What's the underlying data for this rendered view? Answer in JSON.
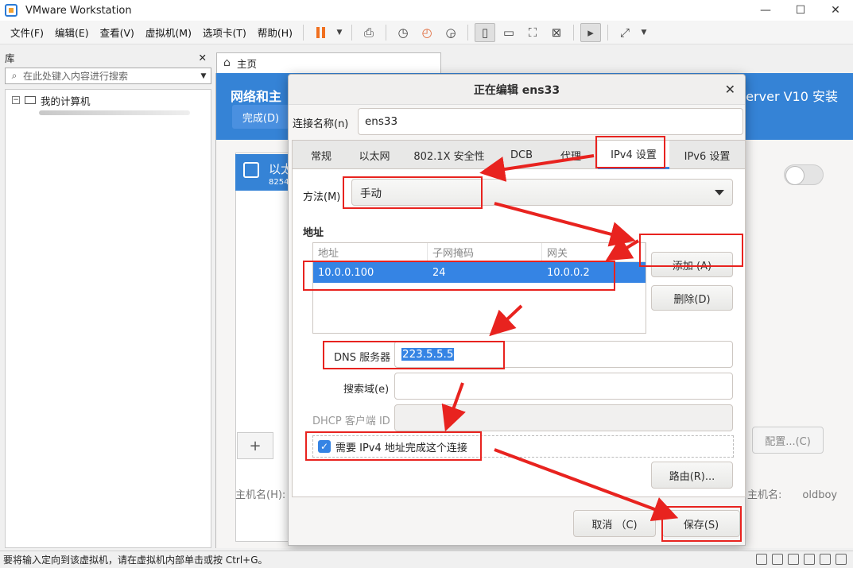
{
  "window": {
    "title": "VMware Workstation",
    "minimize": "—",
    "maximize": "☐",
    "close": "✕"
  },
  "menu": {
    "items": [
      "文件(F)",
      "编辑(E)",
      "查看(V)",
      "虚拟机(M)",
      "选项卡(T)",
      "帮助(H)"
    ]
  },
  "library": {
    "title": "库",
    "close": "✕",
    "search_placeholder": "在此处键入内容进行搜索",
    "tree_root": "我的计算机"
  },
  "tabs": {
    "home": "主页"
  },
  "guest": {
    "header_left": "网络和主",
    "done_button": "完成(D)",
    "header_right": "Server V10 安装",
    "item_name": "以太",
    "item_sub": "8254",
    "add": "+",
    "hostname_label": "主机名(H):",
    "config_button": "配置...(C)",
    "hostname_label_right": "主机名:",
    "hostname_value": "oldboy"
  },
  "dialog": {
    "title": "正在编辑 ens33",
    "close": "✕",
    "connection_name_label": "连接名称(n)",
    "connection_name_value": "ens33",
    "tabs": [
      "常规",
      "以太网",
      "802.1X 安全性",
      "DCB",
      "代理",
      "IPv4 设置",
      "IPv6 设置"
    ],
    "active_tab": "IPv4 设置",
    "method_label": "方法(M)",
    "method_value": "手动",
    "address_heading": "地址",
    "address_columns": [
      "地址",
      "子网掩码",
      "网关"
    ],
    "address_rows": [
      [
        "10.0.0.100",
        "24",
        "10.0.0.2"
      ]
    ],
    "add_button": "添加 (A)",
    "delete_button": "删除(D)",
    "dns_label": "DNS 服务器",
    "dns_value": "223.5.5.5",
    "search_domain_label": "搜索域(e)",
    "search_domain_value": "",
    "dhcp_client_id_label": "DHCP 客户端 ID",
    "dhcp_client_id_value": "",
    "require_ipv4_label": "需要 IPv4 地址完成这个连接",
    "require_ipv4_checked": true,
    "routes_button": "路由(R)...",
    "cancel_button": "取消 （C)",
    "save_button": "保存(S)"
  },
  "status": {
    "text": "要将输入定向到该虚拟机，请在虚拟机内部单击或按 Ctrl+G。"
  },
  "colors": {
    "accent": "#3584e4",
    "annotation": "#e8231f",
    "vmware_pause": "#f07020"
  }
}
